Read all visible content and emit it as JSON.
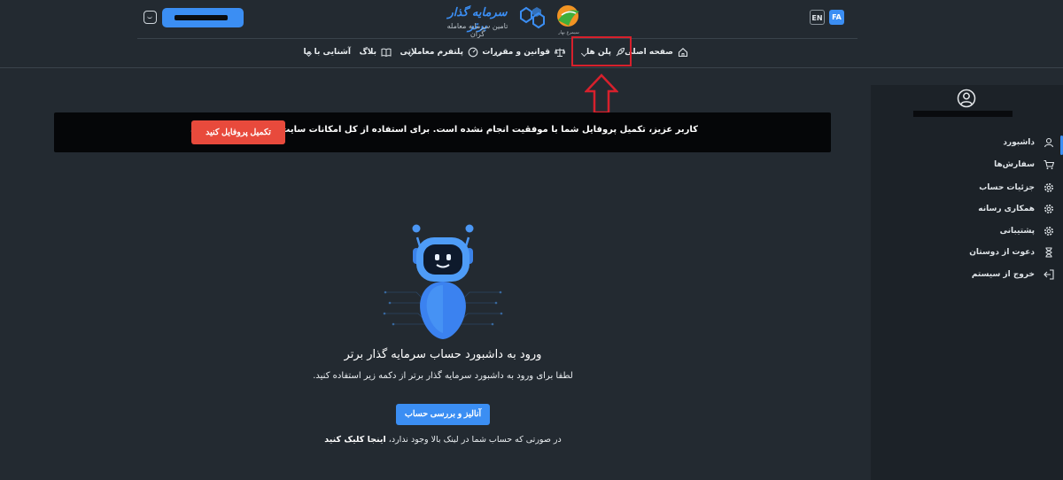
{
  "header": {
    "logo_text": "سرمایه گذار برتر",
    "logo_subtitle": "تامین سرمایه معامله گران",
    "logo_badge_text": "سیمرغ بهار",
    "lang_en": "EN",
    "lang_fa": "FA",
    "accent_color": "#3b8ef3"
  },
  "nav": {
    "items": [
      {
        "label": "صفحه اصلی",
        "icon": "home-icon"
      },
      {
        "label": "پلن ها",
        "icon": "rocket-icon",
        "has_dropdown": true,
        "highlighted": true
      },
      {
        "label": "قوانین و مقررات",
        "icon": "scale-icon",
        "has_dropdown": true
      },
      {
        "label": "پلتفرم معاملاتی",
        "icon": "gauge-icon",
        "has_dropdown": true
      },
      {
        "label": "بلاگ",
        "icon": "book-icon"
      },
      {
        "label": "آشنایی با ما",
        "has_dropdown": true
      }
    ]
  },
  "sidebar": {
    "items": [
      {
        "label": "داشبورد",
        "icon": "user-icon"
      },
      {
        "label": "سفارش‌ها",
        "icon": "cart-icon"
      },
      {
        "label": "جزئیات حساب",
        "icon": "gear-icon"
      },
      {
        "label": "همکاری رسانه",
        "icon": "gear-icon"
      },
      {
        "label": "پشتیبانی",
        "icon": "gear-icon"
      },
      {
        "label": "دعوت از دوستان",
        "icon": "hourglass-icon"
      },
      {
        "label": "خروج از سیستم",
        "icon": "logout-icon"
      }
    ]
  },
  "alert": {
    "text": "کاربر عزیز، تکمیل پروفایل شما با موفقیت انجام نشده است. برای استفاده از کل امکانات سایت تکمیل پروفایل کنید.",
    "button": "تکمیل پروفایل کنید",
    "button_color": "#e84a3c"
  },
  "main": {
    "title": "ورود به داشبورد حساب سرمایه گذار برتر",
    "subtitle": "لطفا برای ورود به داشبورد سرمایه گذار برتر از دکمه زیر استفاده کنید.",
    "button": "آنالیز و بررسی حساب",
    "footer_prefix": "در صورتی که حساب شما در لینک بالا وجود ندارد،",
    "footer_link": "اینجا کلیک کنید"
  }
}
